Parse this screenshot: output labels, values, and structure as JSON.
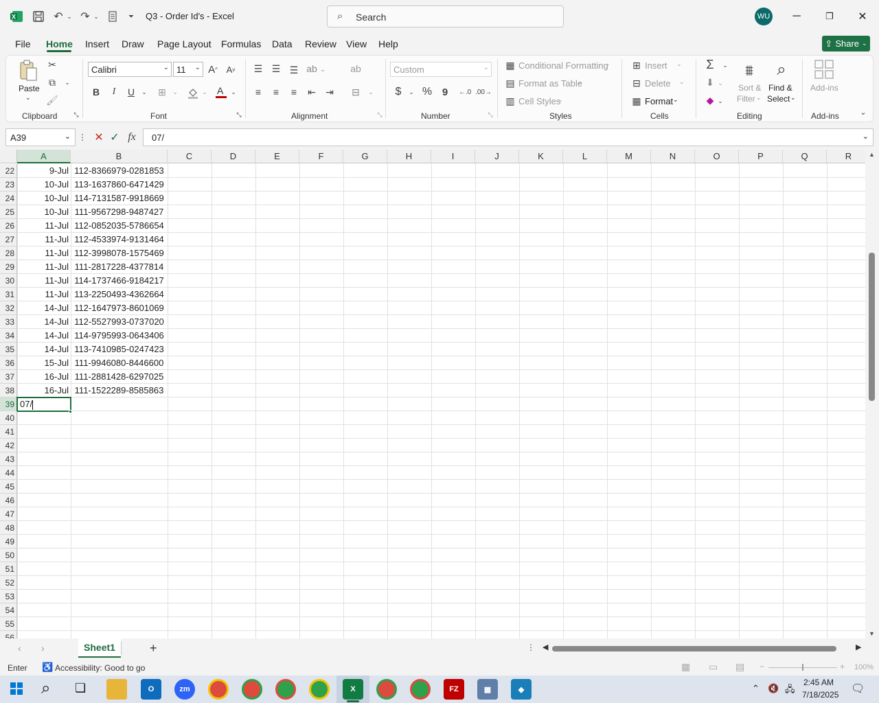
{
  "window": {
    "title": "Q3 - Order Id's  -  Excel",
    "search_placeholder": "Search",
    "user_initials": "WU"
  },
  "tabs": [
    "File",
    "Home",
    "Insert",
    "Draw",
    "Page Layout",
    "Formulas",
    "Data",
    "Review",
    "View",
    "Help"
  ],
  "active_tab": "Home",
  "share_label": "Share",
  "ribbon": {
    "clipboard": {
      "paste": "Paste",
      "label": "Clipboard"
    },
    "font": {
      "name": "Calibri",
      "size": "11",
      "label": "Font",
      "bold": "B",
      "italic": "I",
      "underline": "U"
    },
    "alignment": {
      "label": "Alignment"
    },
    "number": {
      "format": "Custom",
      "label": "Number",
      "currency": "$",
      "percent": "%",
      "comma": "9"
    },
    "styles": {
      "conditional": "Conditional Formatting",
      "format_table": "Format as Table",
      "cell_styles": "Cell Styles",
      "label": "Styles"
    },
    "cells": {
      "insert": "Insert",
      "delete": "Delete",
      "format": "Format",
      "label": "Cells"
    },
    "editing": {
      "sort_filter_1": "Sort &",
      "sort_filter_2": "Filter",
      "find_select_1": "Find &",
      "find_select_2": "Select",
      "label": "Editing"
    },
    "addins": {
      "addins": "Add-ins",
      "label": "Add-ins"
    }
  },
  "formula_bar": {
    "name_box": "A39",
    "formula": "07/"
  },
  "columns": [
    "A",
    "B",
    "C",
    "D",
    "E",
    "F",
    "G",
    "H",
    "I",
    "J",
    "K",
    "L",
    "M",
    "N",
    "O",
    "P",
    "Q",
    "R"
  ],
  "rows": [
    {
      "num": "22",
      "a": "9-Jul",
      "b": "112-8366979-0281853"
    },
    {
      "num": "23",
      "a": "10-Jul",
      "b": "113-1637860-6471429"
    },
    {
      "num": "24",
      "a": "10-Jul",
      "b": "114-7131587-9918669"
    },
    {
      "num": "25",
      "a": "10-Jul",
      "b": "111-9567298-9487427"
    },
    {
      "num": "26",
      "a": "11-Jul",
      "b": "112-0852035-5786654"
    },
    {
      "num": "27",
      "a": "11-Jul",
      "b": "112-4533974-9131464"
    },
    {
      "num": "28",
      "a": "11-Jul",
      "b": "112-3998078-1575469"
    },
    {
      "num": "29",
      "a": "11-Jul",
      "b": "111-2817228-4377814"
    },
    {
      "num": "30",
      "a": "11-Jul",
      "b": "114-1737466-9184217"
    },
    {
      "num": "31",
      "a": "11-Jul",
      "b": "113-2250493-4362664"
    },
    {
      "num": "32",
      "a": "14-Jul",
      "b": "112-1647973-8601069"
    },
    {
      "num": "33",
      "a": "14-Jul",
      "b": "112-5527993-0737020"
    },
    {
      "num": "34",
      "a": "14-Jul",
      "b": "114-9795993-0643406"
    },
    {
      "num": "35",
      "a": "14-Jul",
      "b": "113-7410985-0247423"
    },
    {
      "num": "36",
      "a": "15-Jul",
      "b": "111-9946080-8446600"
    },
    {
      "num": "37",
      "a": "16-Jul",
      "b": "111-2881428-6297025"
    },
    {
      "num": "38",
      "a": "16-Jul",
      "b": "111-1522289-8585863"
    },
    {
      "num": "39",
      "a": "07/",
      "b": ""
    },
    {
      "num": "40",
      "a": "",
      "b": ""
    },
    {
      "num": "41",
      "a": "",
      "b": ""
    },
    {
      "num": "42",
      "a": "",
      "b": ""
    },
    {
      "num": "43",
      "a": "",
      "b": ""
    },
    {
      "num": "44",
      "a": "",
      "b": ""
    },
    {
      "num": "45",
      "a": "",
      "b": ""
    },
    {
      "num": "46",
      "a": "",
      "b": ""
    },
    {
      "num": "47",
      "a": "",
      "b": ""
    },
    {
      "num": "48",
      "a": "",
      "b": ""
    },
    {
      "num": "49",
      "a": "",
      "b": ""
    },
    {
      "num": "50",
      "a": "",
      "b": ""
    },
    {
      "num": "51",
      "a": "",
      "b": ""
    },
    {
      "num": "52",
      "a": "",
      "b": ""
    },
    {
      "num": "53",
      "a": "",
      "b": ""
    },
    {
      "num": "54",
      "a": "",
      "b": ""
    },
    {
      "num": "55",
      "a": "",
      "b": ""
    },
    {
      "num": "56",
      "a": "",
      "b": ""
    }
  ],
  "active_row": "39",
  "sheet": {
    "name": "Sheet1"
  },
  "status": {
    "mode": "Enter",
    "accessibility": "Accessibility: Good to go",
    "zoom": "100%"
  },
  "taskbar": {
    "time": "2:45 AM",
    "date": "7/18/2025"
  },
  "colors": {
    "accent": "#1d6b3c",
    "share": "#1e7145"
  }
}
